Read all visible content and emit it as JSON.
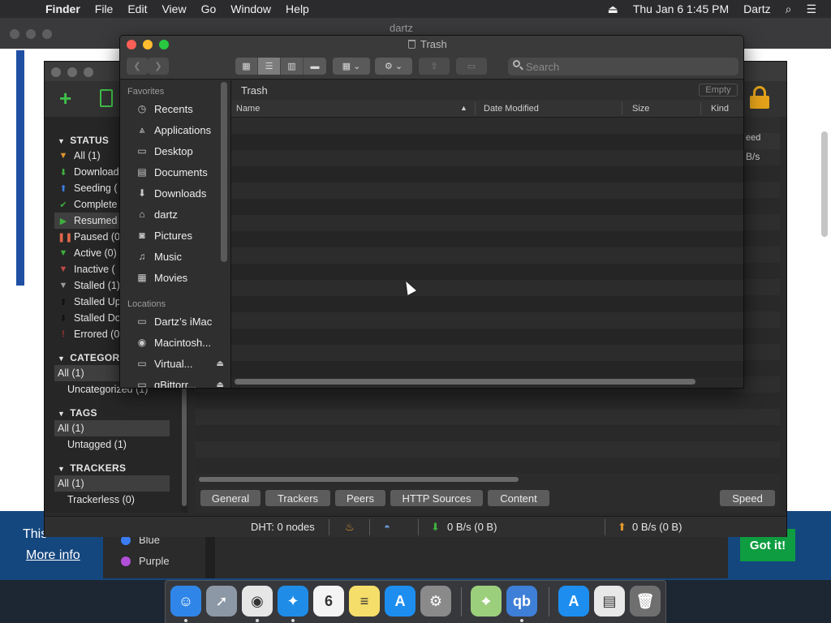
{
  "menubar": {
    "app": "Finder",
    "items": [
      "File",
      "Edit",
      "View",
      "Go",
      "Window",
      "Help"
    ],
    "datetime": "Thu Jan 6  1:45 PM",
    "user": "Dartz"
  },
  "browser": {
    "title": "dartz",
    "banner_text": "This",
    "more_info": "More info",
    "got_it": "Got it!"
  },
  "color_tags": [
    {
      "label": "Blue",
      "color": "#3b7cf2"
    },
    {
      "label": "Purple",
      "color": "#b14fd8"
    }
  ],
  "qbittorrent": {
    "status_header": "STATUS",
    "status_items": [
      {
        "label": "All (1)",
        "icon": "filter-icon",
        "color": "#e0962c"
      },
      {
        "label": "Download",
        "icon": "arrow-down-icon",
        "color": "#3fae3f"
      },
      {
        "label": "Seeding (",
        "icon": "arrow-up-icon",
        "color": "#3a7de0"
      },
      {
        "label": "Complete",
        "icon": "check-icon",
        "color": "#3fae3f"
      },
      {
        "label": "Resumed",
        "icon": "play-icon",
        "color": "#3fae3f"
      },
      {
        "label": "Paused (0",
        "icon": "pause-icon",
        "color": "#e0674a"
      },
      {
        "label": "Active (0)",
        "icon": "filter-icon",
        "color": "#3fae3f"
      },
      {
        "label": "Inactive (",
        "icon": "filter-icon",
        "color": "#c24a4a"
      },
      {
        "label": "Stalled (1)",
        "icon": "filter-icon",
        "color": "#9a9a9a"
      },
      {
        "label": "Stalled Up",
        "icon": "arrow-up-icon",
        "color": "#111111"
      },
      {
        "label": "Stalled Do",
        "icon": "arrow-down-icon",
        "color": "#111111"
      },
      {
        "label": "Errored (0",
        "icon": "exclamation-icon",
        "color": "#e03a3a"
      }
    ],
    "category_header": "CATEGOR",
    "category_items": [
      "All (1)",
      "Uncategorized (1)"
    ],
    "tags_header": "TAGS",
    "tags_items": [
      "All (1)",
      "Untagged (1)"
    ],
    "trackers_header": "TRACKERS",
    "trackers_items": [
      "All (1)",
      "Trackerless (0)"
    ],
    "column_header": "eed",
    "speed_value": "B/s",
    "tabs": [
      "General",
      "Trackers",
      "Peers",
      "HTTP Sources",
      "Content"
    ],
    "speed_tab": "Speed",
    "statusbar": {
      "dht": "DHT: 0 nodes",
      "download": "0 B/s (0 B)",
      "upload": "0 B/s (0 B)"
    }
  },
  "finder": {
    "window_title": "Trash",
    "search_placeholder": "Search",
    "favorites_header": "Favorites",
    "favorites": [
      {
        "label": "Recents",
        "icon": "clock-icon",
        "glyph": "◷"
      },
      {
        "label": "Applications",
        "icon": "applications-icon",
        "glyph": "⩓"
      },
      {
        "label": "Desktop",
        "icon": "desktop-icon",
        "glyph": "▭"
      },
      {
        "label": "Documents",
        "icon": "documents-icon",
        "glyph": "▤"
      },
      {
        "label": "Downloads",
        "icon": "downloads-icon",
        "glyph": "⬇"
      },
      {
        "label": "dartz",
        "icon": "home-icon",
        "glyph": "⌂"
      },
      {
        "label": "Pictures",
        "icon": "camera-icon",
        "glyph": "◙"
      },
      {
        "label": "Music",
        "icon": "music-icon",
        "glyph": "♫"
      },
      {
        "label": "Movies",
        "icon": "film-icon",
        "glyph": "▦"
      }
    ],
    "locations_header": "Locations",
    "locations": [
      {
        "label": "Dartz’s iMac",
        "icon": "imac-icon",
        "glyph": "▭"
      },
      {
        "label": "Macintosh...",
        "icon": "disk-icon",
        "glyph": "◉"
      },
      {
        "label": "Virtual...",
        "icon": "disk-icon",
        "glyph": "▭",
        "eject": "⏏"
      },
      {
        "label": "qBittorr...",
        "icon": "disk-icon",
        "glyph": "▭",
        "eject": "⏏"
      }
    ],
    "path_title": "Trash",
    "empty_button": "Empty",
    "columns": [
      "Name",
      "Date Modified",
      "Size",
      "Kind"
    ]
  },
  "dock": [
    {
      "name": "finder-dock-icon",
      "bg": "#2f86e8",
      "glyph": "☺"
    },
    {
      "name": "launchpad-dock-icon",
      "bg": "#8d98a6",
      "glyph": "➚"
    },
    {
      "name": "chrome-dock-icon",
      "bg": "#e6e6e6",
      "glyph": "◉"
    },
    {
      "name": "safari-dock-icon",
      "bg": "#1f8de8",
      "glyph": "✦"
    },
    {
      "name": "calendar-dock-icon",
      "bg": "#f4f4f4",
      "glyph": "6"
    },
    {
      "name": "notes-dock-icon",
      "bg": "#f6de6a",
      "glyph": "≡"
    },
    {
      "name": "app-store-dock-icon",
      "bg": "#1d8ef0",
      "glyph": "A"
    },
    {
      "name": "system-preferences-dock-icon",
      "bg": "#8a8a8a",
      "glyph": "⚙"
    },
    {
      "name": "maps-dock-icon",
      "bg": "#9ccf7c",
      "glyph": "⌖"
    },
    {
      "name": "qbittorrent-dock-icon",
      "bg": "#3e7fd8",
      "glyph": "qb"
    },
    {
      "name": "app-store-downloads-dock-icon",
      "bg": "#1d8ef0",
      "glyph": "A"
    },
    {
      "name": "document-dock-icon",
      "bg": "#e8e8e8",
      "glyph": "▤"
    },
    {
      "name": "trash-dock-icon",
      "bg": "#6f6f6f",
      "glyph": "🗑"
    }
  ]
}
